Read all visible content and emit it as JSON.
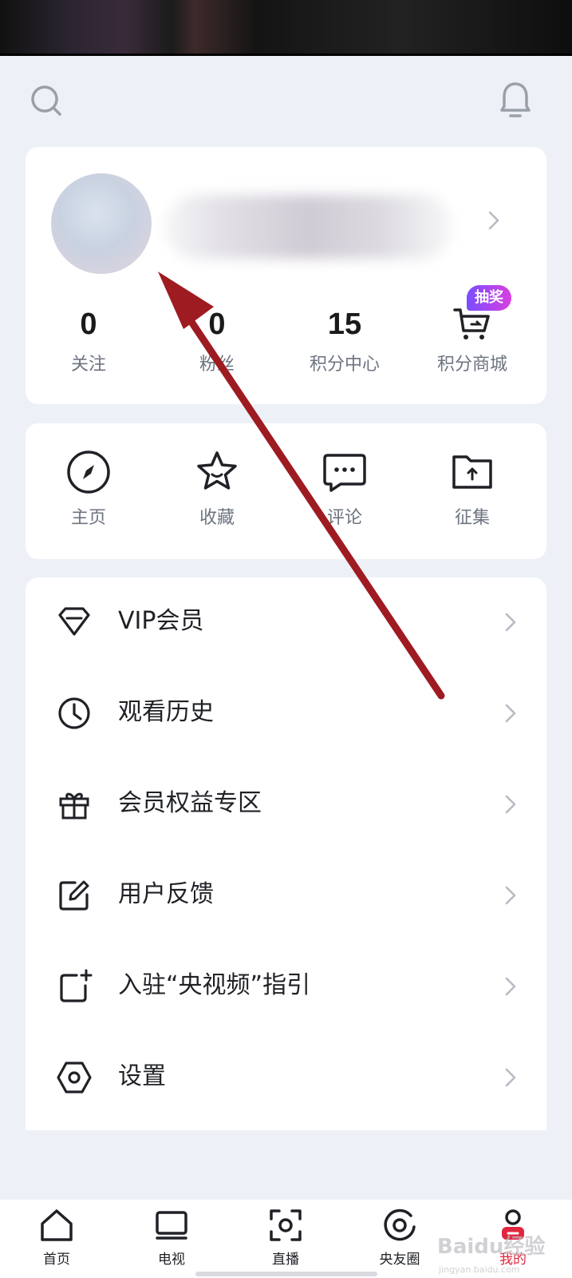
{
  "profile": {
    "stats": [
      {
        "value": "0",
        "label": "关注"
      },
      {
        "value": "0",
        "label": "粉丝"
      },
      {
        "value": "15",
        "label": "积分中心"
      },
      {
        "value": "",
        "label": "积分商城"
      }
    ],
    "badge": "抽奖"
  },
  "quick_actions": [
    {
      "label": "主页",
      "icon": "compass-icon"
    },
    {
      "label": "收藏",
      "icon": "star-icon"
    },
    {
      "label": "评论",
      "icon": "comment-icon"
    },
    {
      "label": "征集",
      "icon": "folder-upload-icon"
    }
  ],
  "menu": [
    {
      "label": "VIP会员",
      "icon": "diamond-icon"
    },
    {
      "label": "观看历史",
      "icon": "clock-icon"
    },
    {
      "label": "会员权益专区",
      "icon": "gift-icon"
    },
    {
      "label": "用户反馈",
      "icon": "edit-icon"
    },
    {
      "label": "入驻“央视频”指引",
      "icon": "add-square-icon"
    },
    {
      "label": "设置",
      "icon": "hexagon-settings-icon"
    }
  ],
  "tabbar": [
    {
      "label": "首页",
      "icon": "home-icon"
    },
    {
      "label": "电视",
      "icon": "tv-icon"
    },
    {
      "label": "直播",
      "icon": "live-icon"
    },
    {
      "label": "央友圈",
      "icon": "circle-icon"
    },
    {
      "label": "我的",
      "icon": "user-icon",
      "active": true
    }
  ],
  "colors": {
    "accent": "#e0263f",
    "background": "#edf1f7",
    "annotation_arrow": "#9e1b22"
  },
  "watermark": {
    "main": "Baidu经验",
    "sub": "jingyan.baidu.com"
  }
}
